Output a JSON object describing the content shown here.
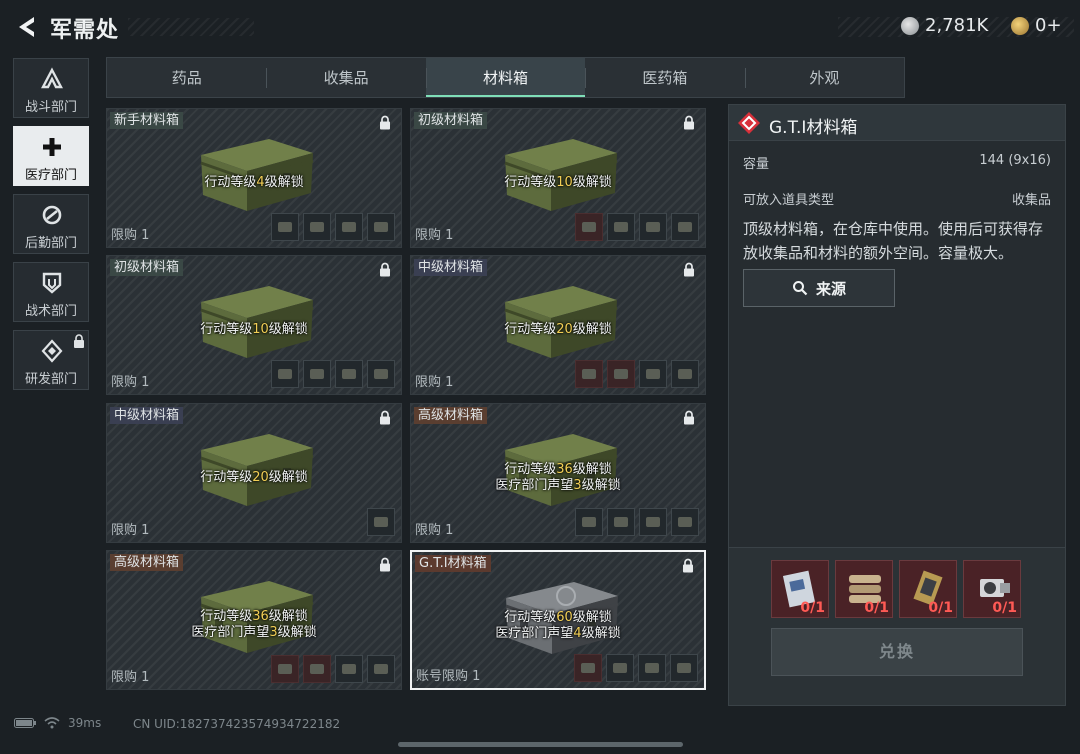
{
  "header": {
    "title": "军需处",
    "currencies": [
      {
        "icon": "silver-coin-icon",
        "value": "2,781K"
      },
      {
        "icon": "gold-coin-icon",
        "value": "0+"
      }
    ]
  },
  "sidebar": {
    "items": [
      {
        "label": "战斗部门",
        "icon": "combat-icon",
        "active": false,
        "locked": false
      },
      {
        "label": "医疗部门",
        "icon": "medical-cross-icon",
        "active": true,
        "locked": false
      },
      {
        "label": "后勤部门",
        "icon": "logistics-icon",
        "active": false,
        "locked": false
      },
      {
        "label": "战术部门",
        "icon": "tactical-shield-icon",
        "active": false,
        "locked": false
      },
      {
        "label": "研发部门",
        "icon": "research-icon",
        "active": false,
        "locked": true
      }
    ]
  },
  "tabs": [
    {
      "label": "药品",
      "active": false
    },
    {
      "label": "收集品",
      "active": false
    },
    {
      "label": "材料箱",
      "active": true
    },
    {
      "label": "医药箱",
      "active": false
    },
    {
      "label": "外观",
      "active": false
    }
  ],
  "cards": [
    {
      "name": "新手材料箱",
      "unlock_line1_pre": "行动等级",
      "unlock_line1_hl": "4",
      "unlock_line1_post": "级解锁",
      "unlock_line2_pre": "",
      "unlock_line2_hl": "",
      "unlock_line2_post": "",
      "limit": "限购 1",
      "selected": false
    },
    {
      "name": "初级材料箱",
      "unlock_line1_pre": "行动等级",
      "unlock_line1_hl": "10",
      "unlock_line1_post": "级解锁",
      "unlock_line2_pre": "",
      "unlock_line2_hl": "",
      "unlock_line2_post": "",
      "limit": "限购 1",
      "selected": false
    },
    {
      "name": "初级材料箱",
      "unlock_line1_pre": "行动等级",
      "unlock_line1_hl": "10",
      "unlock_line1_post": "级解锁",
      "unlock_line2_pre": "",
      "unlock_line2_hl": "",
      "unlock_line2_post": "",
      "limit": "限购 1",
      "selected": false
    },
    {
      "name": "中级材料箱",
      "unlock_line1_pre": "行动等级",
      "unlock_line1_hl": "20",
      "unlock_line1_post": "级解锁",
      "unlock_line2_pre": "",
      "unlock_line2_hl": "",
      "unlock_line2_post": "",
      "limit": "限购 1",
      "selected": false
    },
    {
      "name": "中级材料箱",
      "unlock_line1_pre": "行动等级",
      "unlock_line1_hl": "20",
      "unlock_line1_post": "级解锁",
      "unlock_line2_pre": "",
      "unlock_line2_hl": "",
      "unlock_line2_post": "",
      "limit": "限购 1",
      "selected": false
    },
    {
      "name": "高级材料箱",
      "unlock_line1_pre": "行动等级",
      "unlock_line1_hl": "36",
      "unlock_line1_post": "级解锁",
      "unlock_line2_pre": "医疗部门声望",
      "unlock_line2_hl": "3",
      "unlock_line2_post": "级解锁",
      "limit": "限购 1",
      "selected": false
    },
    {
      "name": "高级材料箱",
      "unlock_line1_pre": "行动等级",
      "unlock_line1_hl": "36",
      "unlock_line1_post": "级解锁",
      "unlock_line2_pre": "医疗部门声望",
      "unlock_line2_hl": "3",
      "unlock_line2_post": "级解锁",
      "limit": "限购 1",
      "selected": false
    },
    {
      "name": "G.T.I材料箱",
      "unlock_line1_pre": "行动等级",
      "unlock_line1_hl": "60",
      "unlock_line1_post": "级解锁",
      "unlock_line2_pre": "医疗部门声望",
      "unlock_line2_hl": "4",
      "unlock_line2_post": "级解锁",
      "limit": "账号限购 1",
      "selected": true
    }
  ],
  "detail": {
    "name": "G.T.I材料箱",
    "capacity_label": "容量",
    "capacity_value": "144 (9x16)",
    "type_label": "可放入道具类型",
    "type_value": "收集品",
    "description": "顶级材料箱，在仓库中使用。使用后可获得存放收集品和材料的额外空间。容量极大。",
    "source_label": "来源",
    "requirements": [
      {
        "icon": "document-card-icon",
        "count": "0/1"
      },
      {
        "icon": "cable-bundle-icon",
        "count": "0/1"
      },
      {
        "icon": "circuit-chip-icon",
        "count": "0/1"
      },
      {
        "icon": "camera-icon",
        "count": "0/1"
      }
    ],
    "exchange_label": "兑换"
  },
  "footer": {
    "ping": "39ms",
    "uid": "CN UID:1827374235749347221​82"
  }
}
